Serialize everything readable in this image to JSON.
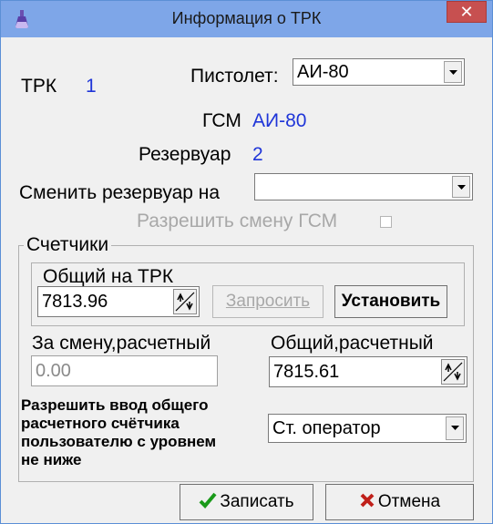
{
  "window": {
    "title": "Информация о ТРК",
    "close_glyph": "✕",
    "icon": "flask-icon",
    "titlebar_color": "#7ea6e8",
    "close_color": "#c75050"
  },
  "trk": {
    "label": "ТРК",
    "value": "1"
  },
  "pistol": {
    "label": "Пистолет:",
    "selected": "АИ-80"
  },
  "gsm": {
    "label": "ГСМ",
    "value": "АИ-80"
  },
  "reservoir": {
    "label": "Резервуар",
    "value": "2"
  },
  "change_reservoir": {
    "label": "Сменить резервуар на",
    "selected": ""
  },
  "allow_gsm": {
    "label": "Разрешить смену ГСМ",
    "checked": false
  },
  "counters": {
    "legend": "Счетчики",
    "total_trk": {
      "legend": "Общий на ТРК",
      "value": "7813.96",
      "request_label": "Запросить",
      "set_label": "Установить"
    },
    "shift_calc": {
      "label": "За смену,расчетный",
      "value": "0.00"
    },
    "total_calc": {
      "label": "Общий,расчетный",
      "value": "7815.61"
    }
  },
  "allow_input": {
    "label_lines": [
      "Разрешить ввод общего",
      "расчетного счётчика",
      "пользователю с уровнем",
      "не ниже"
    ],
    "selected": "Ст. оператор"
  },
  "buttons": {
    "save_label": "Записать",
    "cancel_label": "Отмена",
    "save_icon": "checkmark-icon",
    "cancel_icon": "cross-icon",
    "check_color": "#1a9a1a",
    "cross_color": "#c0201a"
  },
  "colors": {
    "value_blue": "#1f35d8"
  }
}
